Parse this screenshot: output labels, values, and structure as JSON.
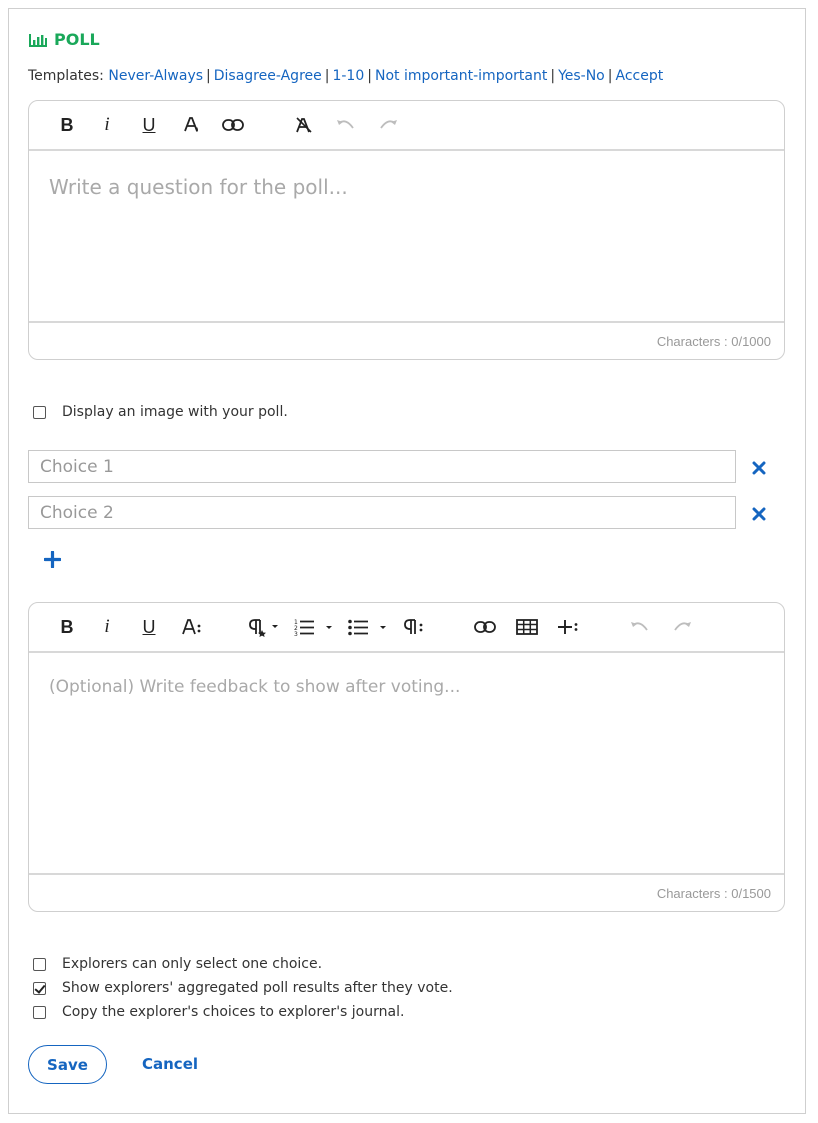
{
  "header": {
    "title": "POLL",
    "icon": "bar-chart-icon",
    "color": "#1aa85a"
  },
  "templates": {
    "label": "Templates:",
    "items": [
      "Never-Always",
      "Disagree-Agree",
      "1-10",
      "Not important-important",
      "Yes-No",
      "Accept"
    ],
    "separator": "|"
  },
  "question_editor": {
    "placeholder": "Write a question for the poll...",
    "counter": "Characters : 0/1000"
  },
  "image_option": {
    "label": "Display an image with your poll.",
    "checked": false
  },
  "choices": [
    {
      "placeholder": "Choice 1"
    },
    {
      "placeholder": "Choice 2"
    }
  ],
  "feedback_editor": {
    "placeholder": "(Optional) Write feedback to show after voting...",
    "counter": "Characters : 0/1500"
  },
  "options": [
    {
      "label": "Explorers can only select one choice.",
      "checked": false
    },
    {
      "label": "Show explorers' aggregated poll results after they vote.",
      "checked": true
    },
    {
      "label": "Copy the explorer's choices to explorer's journal.",
      "checked": false
    }
  ],
  "actions": {
    "save": "Save",
    "cancel": "Cancel"
  },
  "colors": {
    "link": "#1565c0",
    "accent": "#1aa85a",
    "border": "#cfcfcf"
  }
}
